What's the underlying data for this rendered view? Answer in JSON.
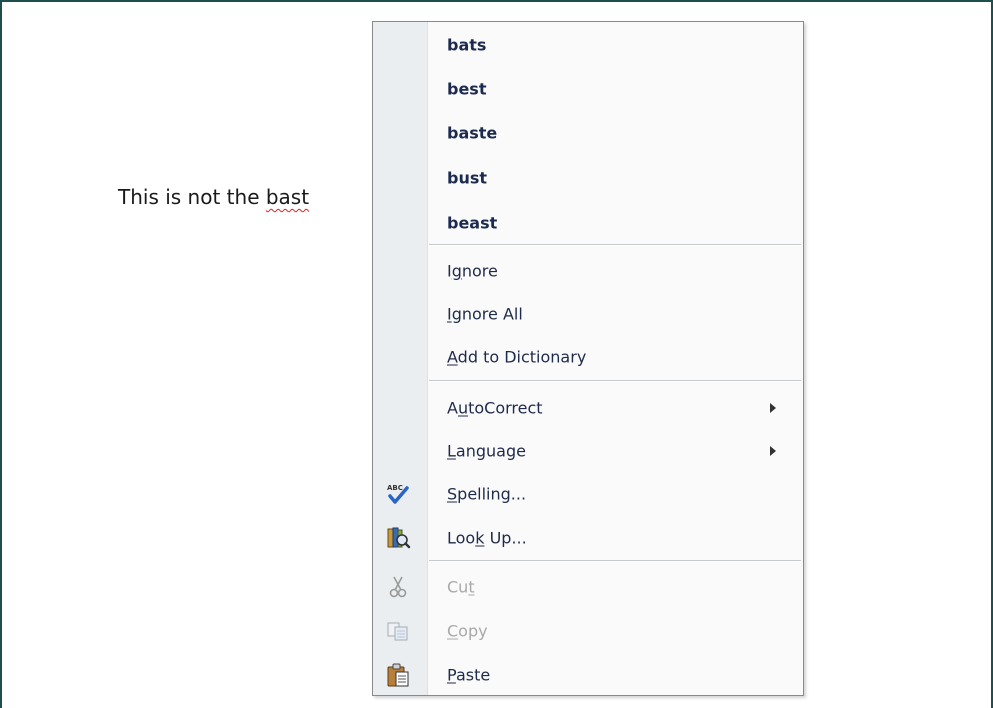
{
  "document": {
    "text_before": "This is not the ",
    "misspelled_word": "bast"
  },
  "context_menu": {
    "suggestions": [
      "bats",
      "best",
      "baste",
      "bust",
      "beast"
    ],
    "ignore": {
      "pre": "I",
      "accel": "g",
      "post": "nore"
    },
    "ignore_all": {
      "pre": "",
      "accel": "I",
      "post": "gnore All"
    },
    "add_to_dictionary": {
      "pre": "",
      "accel": "A",
      "post": "dd to Dictionary"
    },
    "autocorrect": {
      "pre": "A",
      "accel": "u",
      "post": "toCorrect"
    },
    "language": {
      "pre": "",
      "accel": "L",
      "post": "anguage"
    },
    "spelling": {
      "pre": "",
      "accel": "S",
      "post": "pelling...",
      "icon": "spelling-abc-check-icon"
    },
    "look_up": {
      "pre": "Loo",
      "accel": "k",
      "post": " Up...",
      "icon": "research-book-icon"
    },
    "cut": {
      "pre": "Cu",
      "accel": "t",
      "post": "",
      "icon": "scissors-icon",
      "enabled": false
    },
    "copy": {
      "pre": "",
      "accel": "C",
      "post": "opy",
      "icon": "copy-icon",
      "enabled": false
    },
    "paste": {
      "pre": "",
      "accel": "P",
      "post": "aste",
      "icon": "clipboard-paste-icon",
      "enabled": true
    }
  },
  "colors": {
    "frame_border": "#1f4e4e",
    "suggestion_text": "#1c2a4f",
    "disabled_text": "#a9a9a9",
    "spell_underline": "#e02020"
  }
}
